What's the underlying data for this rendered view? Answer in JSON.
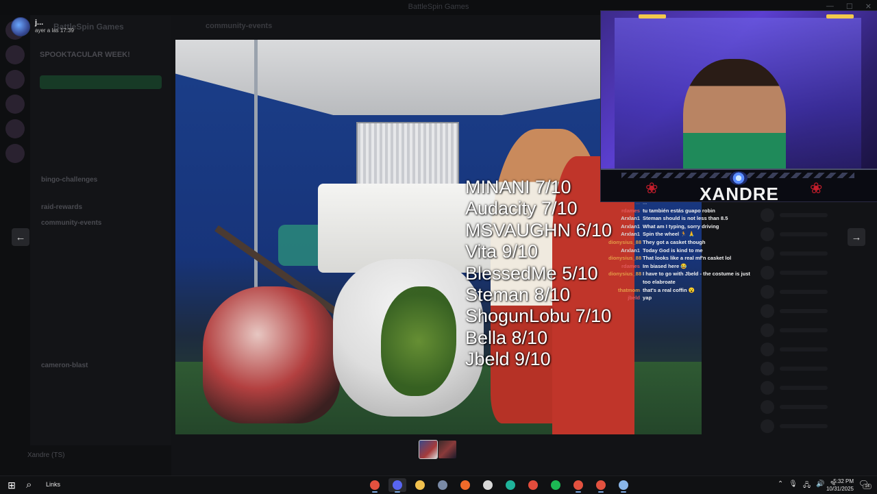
{
  "window": {
    "title": "BattleSpin Games"
  },
  "discord_background": {
    "server_name": "BattleSpin Games",
    "event_banner": "SPOOKTACULAR WEEK!",
    "channels_bold": [
      "bingo-challenges",
      "raid-rewards",
      "community-events",
      "cameron-blast"
    ],
    "current_channel": "community-events",
    "user_name": "Xandre (TS)"
  },
  "post": {
    "author": "j...",
    "timestamp": "ayer a las 17:39"
  },
  "scores": [
    "MINANI 7/10",
    "Audacity 7/10",
    "MSVAUGHN 6/10",
    "Vita 9/10",
    "BlessedMe 5/10",
    "Steman 8/10",
    "ShogunLobu 7/10",
    "Bella 8/10",
    "Jbeld 9/10"
  ],
  "stream": {
    "streamer_name": "XANDRE"
  },
  "chat": [
    {
      "user": "...",
      "text": "...",
      "color": "#e0595a"
    },
    {
      "user": "rdames",
      "text": "tu también estás guapo robin",
      "color": "#e0595a"
    },
    {
      "user": "Arxlan1",
      "text": "Steman should is not less than 8.5",
      "color": "#d9d9d9"
    },
    {
      "user": "Arxlan1",
      "text": "What am I typing, sorry driving",
      "color": "#d9d9d9"
    },
    {
      "user": "Arxlan1",
      "text": "Spin the wheel 🏃 🙏",
      "color": "#d9d9d9"
    },
    {
      "user": "dionysius_88",
      "text": "They got a casket though",
      "color": "#e39a47"
    },
    {
      "user": "Arxlan1",
      "text": "Today God is kind to me",
      "color": "#d9d9d9"
    },
    {
      "user": "dionysius_88",
      "text": "That looks like a real mf'n casket lol",
      "color": "#e39a47"
    },
    {
      "user": "rdames",
      "text": "Im biased here 😂",
      "color": "#e0595a"
    },
    {
      "user": "dionysius_88",
      "text": "I have to go with Jbeld - the costume is just too elabroate",
      "color": "#e39a47"
    },
    {
      "user": "thatmom",
      "text": "that's a real coffin 😮",
      "color": "#e39a47"
    },
    {
      "user": "jbeld",
      "text": "yap",
      "color": "#e0595a"
    }
  ],
  "taskbar": {
    "search_label": "Links",
    "time": "5:32 PM",
    "date": "10/31/2025",
    "notification_count": "14",
    "apps": [
      {
        "name": "chrome-icon",
        "color": "#e2513f"
      },
      {
        "name": "discord-icon",
        "color": "#5865f2"
      },
      {
        "name": "file-explorer-icon",
        "color": "#f2c14e"
      },
      {
        "name": "davinci-resolve-icon",
        "color": "#7a8aa6"
      },
      {
        "name": "brave-icon",
        "color": "#f06a2a"
      },
      {
        "name": "obs-icon",
        "color": "#d8d8d8"
      },
      {
        "name": "app-teal-icon",
        "color": "#1fb39a"
      },
      {
        "name": "calendar-icon",
        "color": "#e24c3c"
      },
      {
        "name": "spotify-icon",
        "color": "#1db954"
      },
      {
        "name": "chrome-2-icon",
        "color": "#e2513f"
      },
      {
        "name": "chrome-3-icon",
        "color": "#e2513f"
      },
      {
        "name": "notes-icon",
        "color": "#8ab6e8"
      }
    ]
  },
  "accent": {
    "scores_text": "#ffffff",
    "overlay_dim": "#0b0c0e"
  }
}
